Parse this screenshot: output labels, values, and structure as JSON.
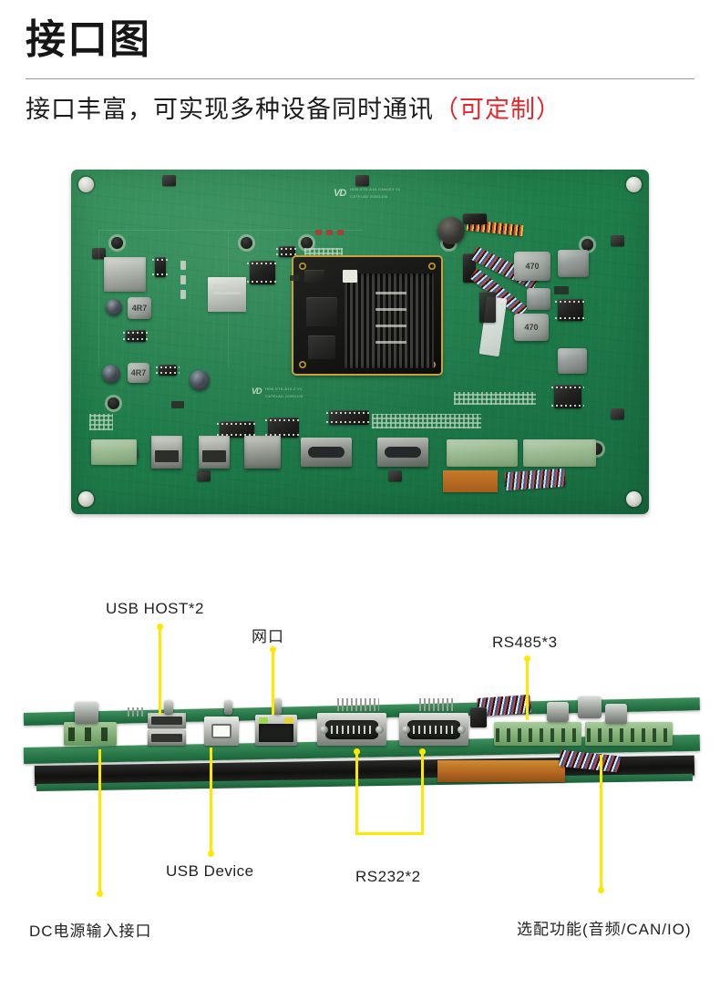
{
  "header": {
    "title": "接口图",
    "subtitle_main": "接口丰富，可实现多种设备同时通讯",
    "subtitle_accent": "（可定制）",
    "accent_color": "#e0282e",
    "rule_color": "#9a9a9a"
  },
  "diagram": {
    "leader_color": "#ffe800",
    "board_color": "#20804a",
    "top_view_alt": "主板顶视图",
    "side_view_alt": "主板接口侧视图"
  },
  "callouts": [
    {
      "id": "usb-host",
      "label": "USB HOST*2"
    },
    {
      "id": "lan",
      "label": "网口"
    },
    {
      "id": "rs485",
      "label": "RS485*3"
    },
    {
      "id": "usb-device",
      "label": "USB Device"
    },
    {
      "id": "rs232",
      "label": "RS232*2"
    },
    {
      "id": "dc-power",
      "label": "DC电源输入接口"
    },
    {
      "id": "optional",
      "label": "选配功能(音频/CAN/IO)"
    }
  ],
  "silkscreen": {
    "logo": "VD",
    "line1": "HDB-STK-A10-CANZE3 V1",
    "line2": "CATELAD  20091100",
    "line3": "HDB-STK-A10-Z V1",
    "line4": "CATELAD  20091100"
  }
}
